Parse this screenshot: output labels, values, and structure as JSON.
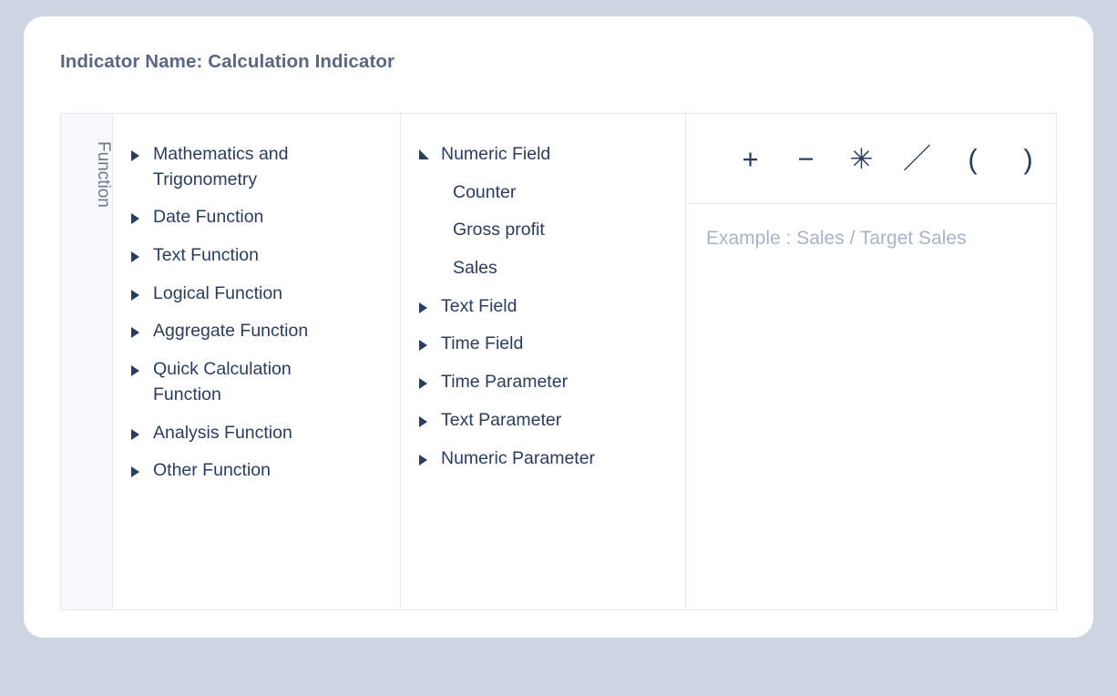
{
  "window": {
    "card_background": "#ffffff",
    "page_background": "#ccd5e0"
  },
  "header": {
    "title": "Indicator Name: Calculation Indicator",
    "title_color": "#5a6784"
  },
  "rail": {
    "label": "Function"
  },
  "categories": {
    "items": [
      {
        "label": "Mathematics and Trigonometry",
        "state": "collapsed",
        "icon": "triangle-right-icon"
      },
      {
        "label": "Date Function",
        "state": "collapsed",
        "icon": "triangle-right-icon"
      },
      {
        "label": "Text Function",
        "state": "collapsed",
        "icon": "triangle-right-icon"
      },
      {
        "label": "Logical Function",
        "state": "collapsed",
        "icon": "triangle-right-icon"
      },
      {
        "label": "Aggregate Function",
        "state": "collapsed",
        "icon": "triangle-right-icon"
      },
      {
        "label": "Quick Calculation Function",
        "state": "collapsed",
        "icon": "triangle-right-icon"
      },
      {
        "label": "Analysis Function",
        "state": "collapsed",
        "icon": "triangle-right-icon"
      },
      {
        "label": "Other Function",
        "state": "collapsed",
        "icon": "triangle-right-icon"
      }
    ]
  },
  "fields": {
    "items": [
      {
        "label": "Numeric Field",
        "state": "expanded",
        "icon": "triangle-up-left-icon",
        "level": 0
      },
      {
        "label": "Counter",
        "state": "leaf",
        "icon": "none",
        "level": 1
      },
      {
        "label": "Gross profit",
        "state": "leaf",
        "icon": "none",
        "level": 1
      },
      {
        "label": "Sales",
        "state": "leaf",
        "icon": "none",
        "level": 1
      },
      {
        "label": "Text Field",
        "state": "collapsed",
        "icon": "triangle-right-icon",
        "level": 0
      },
      {
        "label": "Time Field",
        "state": "collapsed",
        "icon": "triangle-right-icon",
        "level": 0
      },
      {
        "label": "Time Parameter",
        "state": "collapsed",
        "icon": "triangle-right-icon",
        "level": 0
      },
      {
        "label": "Text Parameter",
        "state": "collapsed",
        "icon": "triangle-right-icon",
        "level": 0
      },
      {
        "label": "Numeric Parameter",
        "state": "collapsed",
        "icon": "triangle-right-icon",
        "level": 0
      }
    ]
  },
  "formula": {
    "operators": [
      {
        "label": "+",
        "name": "plus"
      },
      {
        "label": "−",
        "name": "minus"
      },
      {
        "label": "✳",
        "name": "multiply"
      },
      {
        "label": "／",
        "name": "divide"
      },
      {
        "label": "(",
        "name": "open-paren"
      },
      {
        "label": ")",
        "name": "close-paren"
      }
    ],
    "editor_value": "",
    "editor_placeholder": "Example : Sales / Target Sales",
    "placeholder_color": "#a8b3c6",
    "text_color": "#293d5e"
  }
}
